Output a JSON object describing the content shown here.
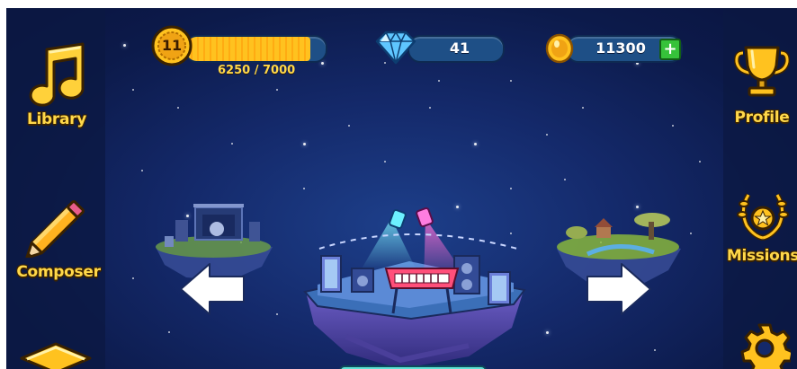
{
  "hud": {
    "level": "11",
    "xp_text": "6250 / 7000",
    "xp_progress": 0.893,
    "gems": "41",
    "coins": "11300",
    "add_coins_symbol": "+"
  },
  "left_menu": {
    "library_label": "Library",
    "composer_label": "Composer"
  },
  "right_menu": {
    "profile_label": "Profile",
    "missions_label": "Missions"
  },
  "stages": {
    "left": "concert-stage-island",
    "center": "synthesizer-stage-island",
    "right": "village-island"
  },
  "colors": {
    "gold": "#ffd84a",
    "pill_blue": "#1e4f86",
    "xp_fill": "#ffc21f",
    "add_green": "#36c23a",
    "background": "#14296a"
  }
}
